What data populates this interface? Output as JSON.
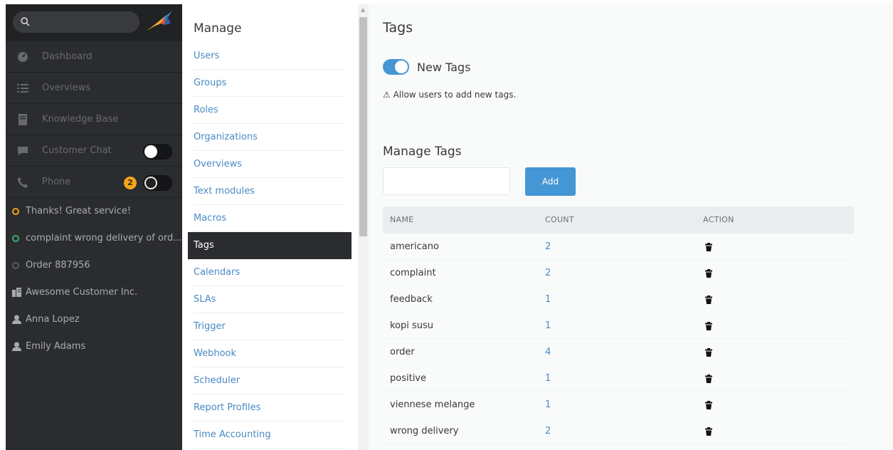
{
  "nav": {
    "items": [
      {
        "label": "Dashboard",
        "icon": "dashboard-icon"
      },
      {
        "label": "Overviews",
        "icon": "overviews-icon"
      },
      {
        "label": "Knowledge Base",
        "icon": "knowledge-base-icon"
      },
      {
        "label": "Customer Chat",
        "icon": "chat-icon"
      },
      {
        "label": "Phone",
        "icon": "phone-icon",
        "badge": "2"
      }
    ],
    "tasks": [
      {
        "label": "Thanks! Great service!",
        "status_color": "#f4a41b"
      },
      {
        "label": "complaint wrong delivery of ord...",
        "status_color": "#38ad69"
      },
      {
        "label": "Order 887956",
        "status_color": "#5a5c5f"
      },
      {
        "label": "Awesome Customer Inc.",
        "icon": "organization-icon"
      },
      {
        "label": "Anna Lopez",
        "icon": "user-icon"
      },
      {
        "label": "Emily Adams",
        "icon": "user-icon"
      }
    ]
  },
  "manage": {
    "title": "Manage",
    "items": [
      "Users",
      "Groups",
      "Roles",
      "Organizations",
      "Overviews",
      "Text modules",
      "Macros",
      "Tags",
      "Calendars",
      "SLAs",
      "Trigger",
      "Webhook",
      "Scheduler",
      "Report Profiles",
      "Time Accounting"
    ],
    "active": "Tags"
  },
  "content": {
    "title": "Tags",
    "new_tags_label": "New Tags",
    "new_tags_enabled": true,
    "hint": "⚠ Allow users to add new tags.",
    "manage_title": "Manage Tags",
    "add_label": "Add",
    "tag_input_value": "",
    "table": {
      "headers": [
        "NAME",
        "COUNT",
        "ACTION"
      ],
      "rows": [
        {
          "name": "americano",
          "count": "2"
        },
        {
          "name": "complaint",
          "count": "2"
        },
        {
          "name": "feedback",
          "count": "1"
        },
        {
          "name": "kopi susu",
          "count": "1"
        },
        {
          "name": "order",
          "count": "4"
        },
        {
          "name": "positive",
          "count": "1"
        },
        {
          "name": "viennese melange",
          "count": "1"
        },
        {
          "name": "wrong delivery",
          "count": "2"
        }
      ]
    }
  },
  "colors": {
    "accent": "#4596d4",
    "link": "#4a8ac5",
    "nav_bg": "#2b2c2f",
    "badge": "#f4a41b"
  }
}
